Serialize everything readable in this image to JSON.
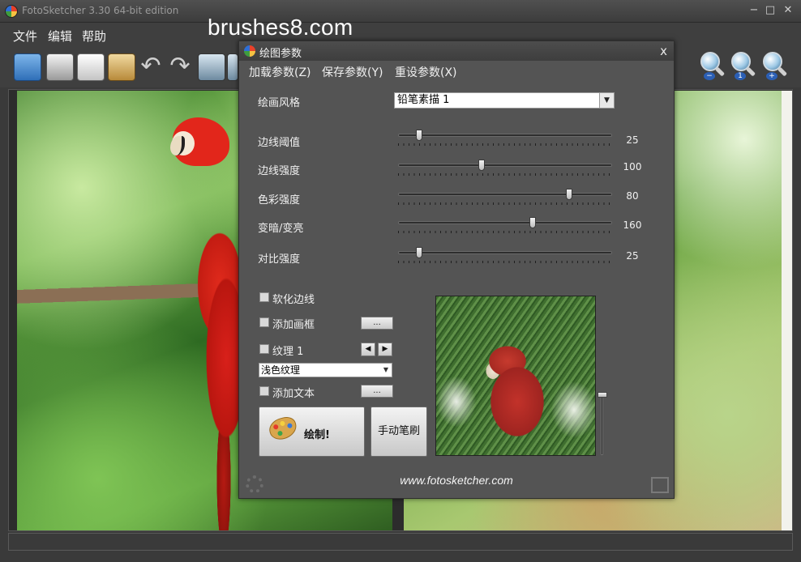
{
  "app": {
    "title": "FotoSketcher 3.30 64-bit edition",
    "minimize": "−",
    "maximize": "□",
    "close": "✕"
  },
  "watermark": "brushes8.com",
  "menu": [
    "文件",
    "编辑",
    "帮助"
  ],
  "toolbar": {
    "icons": [
      "open-image-icon",
      "save-icon",
      "copy-icon",
      "paste-icon",
      "undo-icon",
      "redo-icon",
      "filmstrip-icon",
      "display-icon"
    ],
    "zoom": [
      "zoom-out-icon",
      "zoom-fit-icon",
      "zoom-in-icon"
    ],
    "zoom_signs": [
      "−",
      "1",
      "+"
    ]
  },
  "dialog": {
    "title": "绘图参数",
    "close": "x",
    "menu": [
      "加载参数(Z)",
      "保存参数(Y)",
      "重设参数(X)"
    ],
    "style_label": "绘画风格",
    "style_value": "铅笔素描 1",
    "sliders": [
      {
        "label": "边线阈值",
        "value": "25",
        "fraction": 0.1
      },
      {
        "label": "边线强度",
        "value": "100",
        "fraction": 0.39
      },
      {
        "label": "色彩强度",
        "value": "80",
        "fraction": 0.8
      },
      {
        "label": "变暗/变亮",
        "value": "160",
        "fraction": 0.63
      },
      {
        "label": "对比强度",
        "value": "25",
        "fraction": 0.1
      }
    ],
    "soften_edges": "软化边线",
    "add_frame": "添加画框",
    "texture": "纹理 1",
    "texture_value": "浅色纹理",
    "add_text": "添加文本",
    "ellipsis": "...",
    "prev": "◀",
    "next": "▶",
    "draw_button": "绘制!",
    "manual_button": "手动笔刷",
    "website": "www.fotosketcher.com"
  }
}
